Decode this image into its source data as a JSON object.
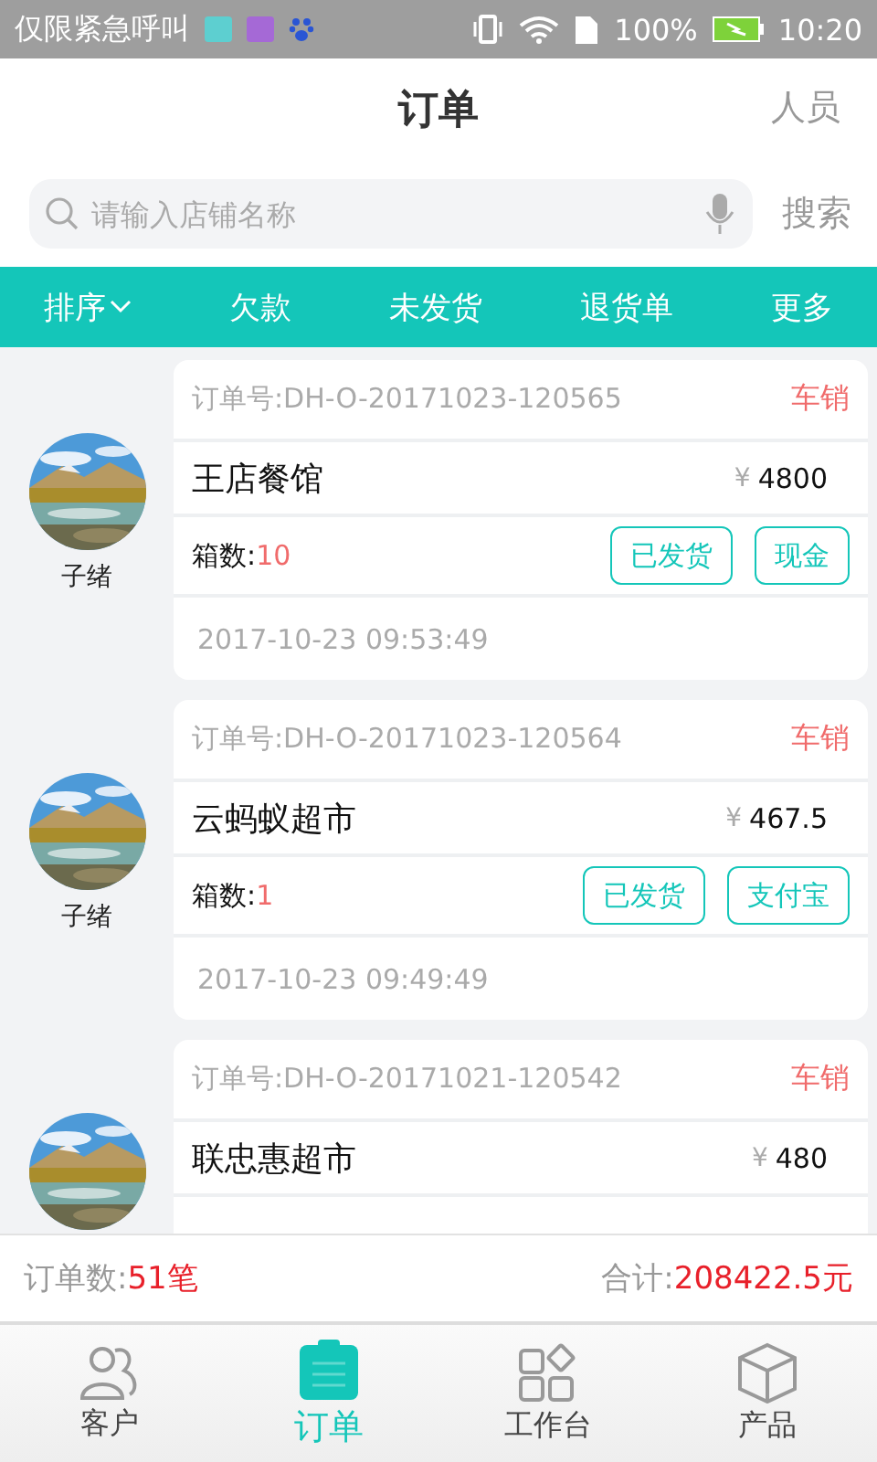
{
  "status_bar": {
    "notice": "仅限紧急呼叫",
    "battery": "100%",
    "time": "10:20"
  },
  "header": {
    "title": "订单",
    "action": "人员"
  },
  "search": {
    "placeholder": "请输入店铺名称",
    "button": "搜索"
  },
  "filters": [
    {
      "label": "排序",
      "kind": "dropdown"
    },
    {
      "label": "欠款",
      "kind": "plain"
    },
    {
      "label": "未发货",
      "kind": "plain"
    },
    {
      "label": "退货单",
      "kind": "plain"
    },
    {
      "label": "更多",
      "kind": "plain"
    }
  ],
  "orders": [
    {
      "order_no": "订单号:DH-O-20171023-120565",
      "tag": "车销",
      "customer": "子绪",
      "store": "王店餐馆",
      "currency": "¥",
      "amount": "4800",
      "boxes_label": "箱数:",
      "boxes": "10",
      "status": "已发货",
      "payment": "现金",
      "time": "2017-10-23 09:53:49"
    },
    {
      "order_no": "订单号:DH-O-20171023-120564",
      "tag": "车销",
      "customer": "子绪",
      "store": "云蚂蚁超市",
      "currency": "¥",
      "amount": "467.5",
      "boxes_label": "箱数:",
      "boxes": "1",
      "status": "已发货",
      "payment": "支付宝",
      "time": "2017-10-23 09:49:49"
    },
    {
      "order_no": "订单号:DH-O-20171021-120542",
      "tag": "车销",
      "store": "联忠惠超市",
      "currency": "¥",
      "amount": "480"
    }
  ],
  "summary": {
    "count_label": "订单数:",
    "count": "51笔",
    "total_label": "合计:",
    "total": "208422.5元"
  },
  "nav": [
    {
      "label": "客户",
      "kind": "people",
      "selected": false
    },
    {
      "label": "订单",
      "kind": "clipboard",
      "selected": true
    },
    {
      "label": "工作台",
      "kind": "grid",
      "selected": false
    },
    {
      "label": "产品",
      "kind": "cube",
      "selected": false
    }
  ]
}
